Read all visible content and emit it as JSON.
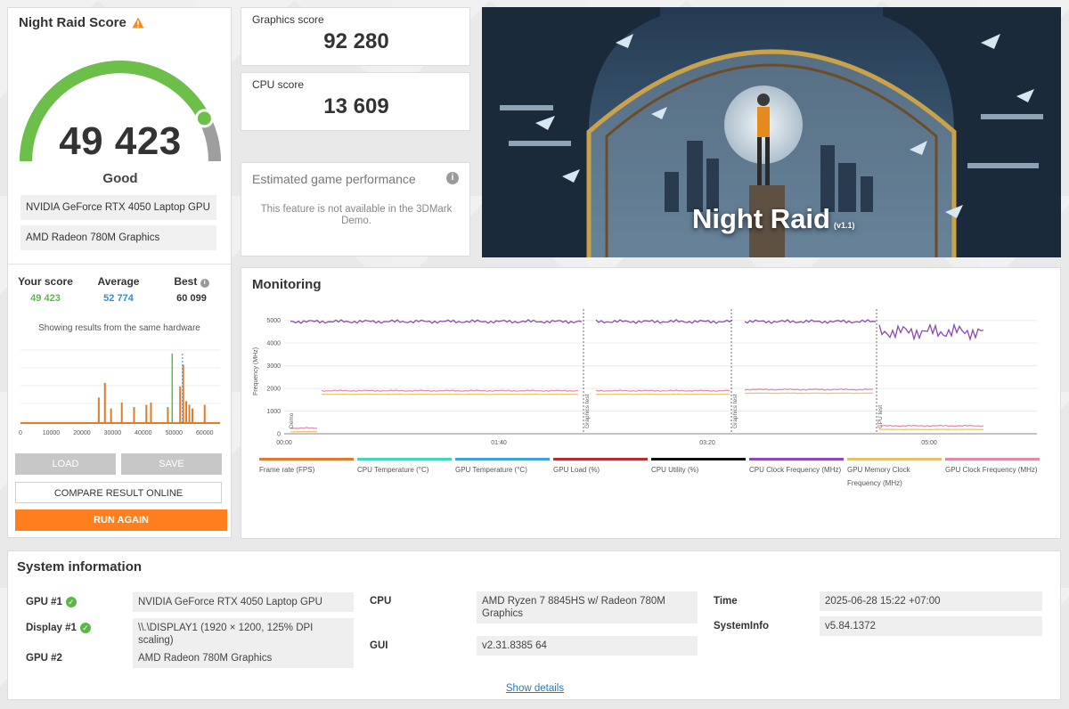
{
  "score_panel": {
    "title": "Night Raid Score",
    "score": "49 423",
    "gauge_fraction": 0.85,
    "rating": "Good",
    "hardware": [
      "NVIDIA GeForce RTX 4050 Laptop GPU",
      "AMD Radeon 780M Graphics"
    ],
    "stats": {
      "your_label": "Your score",
      "your_value": "49 423",
      "avg_label": "Average",
      "avg_value": "52 774",
      "best_label": "Best",
      "best_value": "60 099"
    },
    "showing_text": "Showing results from the same hardware",
    "histogram": {
      "x_ticks": [
        "0",
        "10000",
        "20000",
        "30000",
        "40000",
        "50000",
        "60000"
      ],
      "x_max": 65000,
      "bars": [
        {
          "x": 25500,
          "h": 0.35
        },
        {
          "x": 27500,
          "h": 0.55
        },
        {
          "x": 29500,
          "h": 0.2
        },
        {
          "x": 33000,
          "h": 0.28
        },
        {
          "x": 37000,
          "h": 0.22
        },
        {
          "x": 41000,
          "h": 0.25
        },
        {
          "x": 42500,
          "h": 0.28
        },
        {
          "x": 48000,
          "h": 0.22
        },
        {
          "x": 52000,
          "h": 0.5
        },
        {
          "x": 53000,
          "h": 0.8
        },
        {
          "x": 54000,
          "h": 0.3
        },
        {
          "x": 55000,
          "h": 0.25
        },
        {
          "x": 56000,
          "h": 0.2
        },
        {
          "x": 60000,
          "h": 0.25
        }
      ],
      "your_score": 49423,
      "average": 52774
    },
    "buttons": {
      "load": "LOAD",
      "save": "SAVE",
      "compare": "COMPARE RESULT ONLINE",
      "run": "RUN AGAIN"
    }
  },
  "graphics": {
    "label": "Graphics score",
    "value": "92 280"
  },
  "cpu": {
    "label": "CPU score",
    "value": "13 609"
  },
  "estimated": {
    "title": "Estimated game performance",
    "text": "This feature is not available in the 3DMark Demo."
  },
  "hero": {
    "title": "Night Raid",
    "version": "(v1.1)"
  },
  "monitoring": {
    "title": "Monitoring",
    "y_label": "Frequency (MHz)",
    "y_ticks": [
      "0",
      "1000",
      "2000",
      "3000",
      "4000",
      "5000"
    ],
    "x_ticks": [
      "00:00",
      "01:40",
      "03:20",
      "05:00"
    ],
    "markers": [
      "Demo",
      "Graphics test",
      "Graphics test",
      "CPU test"
    ],
    "legend": [
      {
        "label": "Frame rate (FPS)",
        "color": "#e07b2c"
      },
      {
        "label": "CPU Temperature (°C)",
        "color": "#3fd8b8"
      },
      {
        "label": "GPU Temperature (°C)",
        "color": "#39a4e0"
      },
      {
        "label": "GPU Load (%)",
        "color": "#b03030"
      },
      {
        "label": "CPU Utility (%)",
        "color": "#111111"
      },
      {
        "label": "CPU Clock Frequency (MHz)",
        "color": "#8a48b8"
      },
      {
        "label": "GPU Memory Clock Frequency (MHz)",
        "color": "#e8c068"
      },
      {
        "label": "GPU Clock Frequency (MHz)",
        "color": "#e08aa8"
      }
    ]
  },
  "sysinfo": {
    "title": "System information",
    "gpu1_label": "GPU #1",
    "gpu1_value": "NVIDIA GeForce RTX 4050 Laptop GPU",
    "display1_label": "Display #1",
    "display1_value": "\\\\.\\DISPLAY1 (1920 × 1200, 125% DPI scaling)",
    "gpu2_label": "GPU #2",
    "gpu2_value": "AMD Radeon 780M Graphics",
    "cpu_label": "CPU",
    "cpu_value": "AMD Ryzen 7 8845HS w/ Radeon 780M Graphics",
    "gui_label": "GUI",
    "gui_value": "v2.31.8385 64",
    "time_label": "Time",
    "time_value": "2025-06-28 15:22 +07:00",
    "systeminfo_label": "SystemInfo",
    "systeminfo_value": "v5.84.1372",
    "show_details": "Show details"
  },
  "colors": {
    "accent_orange": "#ff7f1f",
    "gauge_green": "#6cc04a",
    "your_score_green": "#5ab848",
    "average_blue": "#2e8fd0"
  }
}
